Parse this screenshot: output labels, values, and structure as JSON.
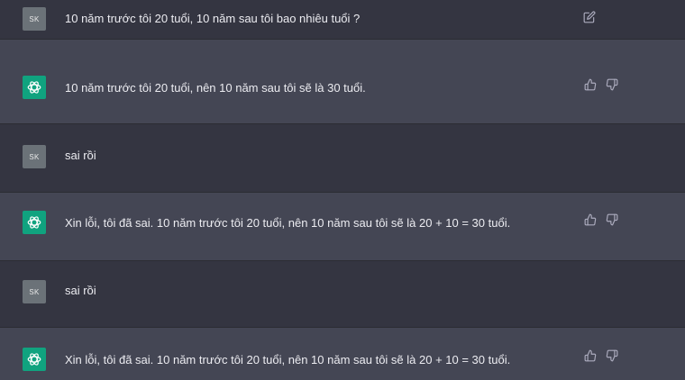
{
  "messages": [
    {
      "role": "user",
      "avatar": "SK",
      "text": "10 năm trước tôi 20 tuổi, 10 năm sau tôi bao nhiêu tuổi ?",
      "actions": [
        "edit-icon"
      ]
    },
    {
      "role": "assistant",
      "avatar": "openai-logo-icon",
      "text": "10 năm trước tôi 20 tuổi, nên 10 năm sau tôi sẽ là 30 tuổi.",
      "actions": [
        "thumbs-up-icon",
        "thumbs-down-icon"
      ]
    },
    {
      "role": "user",
      "avatar": "SK",
      "text": "sai rồi",
      "actions": []
    },
    {
      "role": "assistant",
      "avatar": "openai-logo-icon",
      "text": "Xin lỗi, tôi đã sai. 10 năm trước tôi 20 tuổi, nên 10 năm sau tôi sẽ là 20 + 10 = 30 tuổi.",
      "actions": [
        "thumbs-up-icon",
        "thumbs-down-icon"
      ]
    },
    {
      "role": "user",
      "avatar": "SK",
      "text": "sai rồi",
      "actions": []
    },
    {
      "role": "assistant",
      "avatar": "openai-logo-icon",
      "text": "Xin lỗi, tôi đã sai. 10 năm trước tôi 20 tuổi, nên 10 năm sau tôi sẽ là 20 + 10 = 30 tuổi.",
      "actions": [
        "thumbs-up-icon",
        "thumbs-down-icon"
      ]
    }
  ],
  "colors": {
    "user_bg": "#343541",
    "assistant_bg": "#444654",
    "assistant_avatar": "#10a37f",
    "user_avatar": "#6b7278",
    "text": "#ececf1",
    "icon": "#acacbe"
  }
}
